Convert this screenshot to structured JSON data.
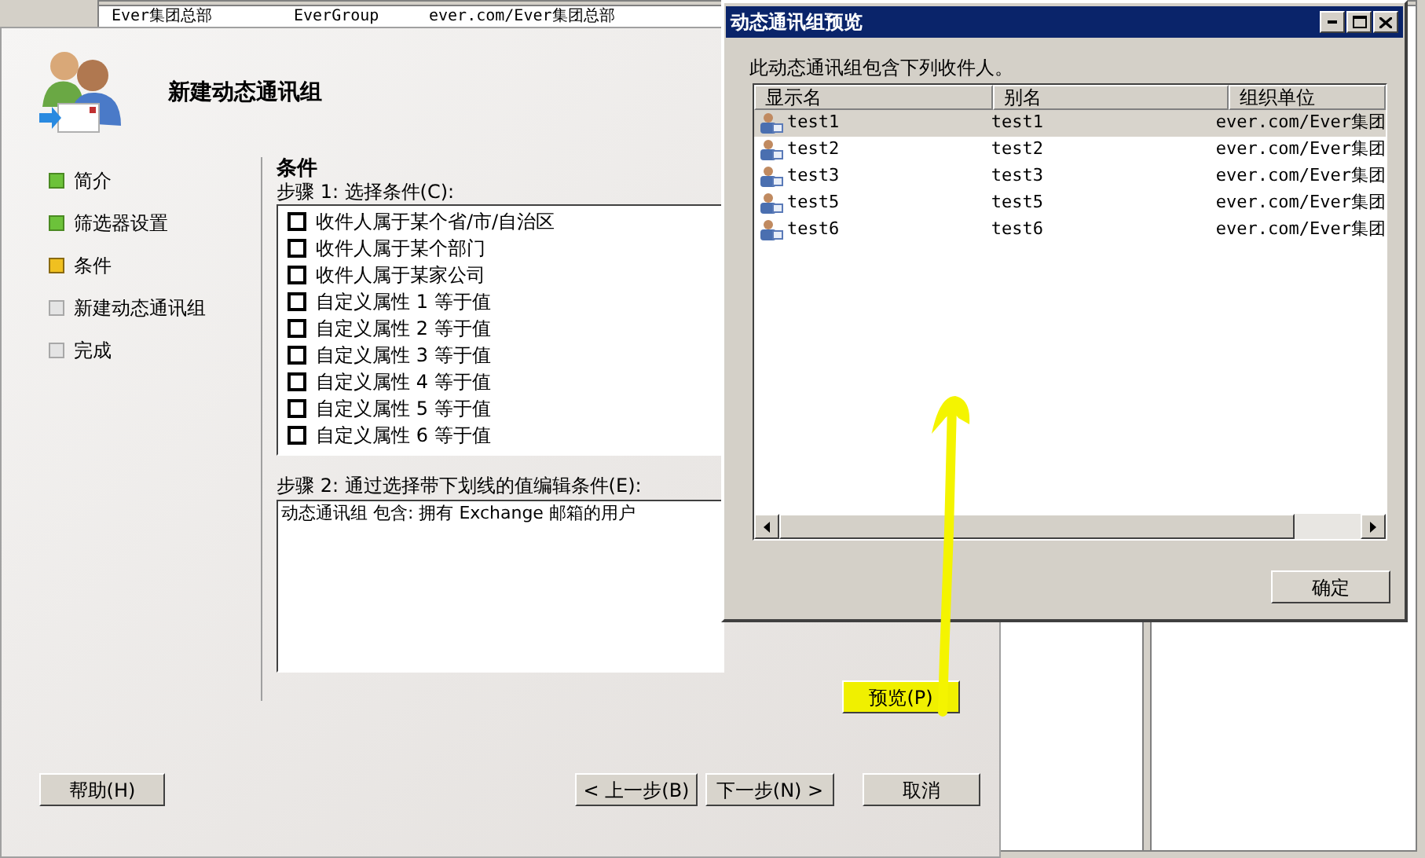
{
  "background_window": {
    "row": {
      "display_name": "Ever集团总部",
      "alias": "EverGroup",
      "org_unit": "ever.com/Ever集团总部"
    }
  },
  "wizard": {
    "title": "新建动态通讯组",
    "steps": [
      {
        "label": "简介",
        "kind": "done"
      },
      {
        "label": "筛选器设置",
        "kind": "done"
      },
      {
        "label": "条件",
        "kind": "current"
      },
      {
        "label": "新建动态通讯组",
        "kind": "pending"
      },
      {
        "label": "完成",
        "kind": "pending"
      }
    ],
    "section_title": "条件",
    "step1_label": "步骤 1: 选择条件(C):",
    "conditions": [
      {
        "label": "收件人属于某个省/市/自治区",
        "checked": false
      },
      {
        "label": "收件人属于某个部门",
        "checked": false
      },
      {
        "label": "收件人属于某家公司",
        "checked": false
      },
      {
        "label": "自定义属性 1 等于值",
        "checked": false
      },
      {
        "label": "自定义属性 2 等于值",
        "checked": false
      },
      {
        "label": "自定义属性 3 等于值",
        "checked": false
      },
      {
        "label": "自定义属性 4 等于值",
        "checked": false
      },
      {
        "label": "自定义属性 5 等于值",
        "checked": false
      },
      {
        "label": "自定义属性 6 等于值",
        "checked": false
      }
    ],
    "step2_label": "步骤 2: 通过选择带下划线的值编辑条件(E):",
    "condition_text": "动态通讯组 包含: 拥有 Exchange 邮箱的用户",
    "preview_button": "预览(P)",
    "help_button": "帮助(H)",
    "back_button": "< 上一步(B)",
    "next_button": "下一步(N) >",
    "cancel_button": "取消"
  },
  "preview_dialog": {
    "title": "动态通讯组预览",
    "intro": "此动态通讯组包含下列收件人。",
    "columns": [
      "显示名",
      "别名",
      "组织单位"
    ],
    "rows": [
      {
        "display_name": "test1",
        "alias": "test1",
        "org_unit": "ever.com/Ever集团",
        "selected": true
      },
      {
        "display_name": "test2",
        "alias": "test2",
        "org_unit": "ever.com/Ever集团",
        "selected": false
      },
      {
        "display_name": "test3",
        "alias": "test3",
        "org_unit": "ever.com/Ever集团",
        "selected": false
      },
      {
        "display_name": "test5",
        "alias": "test5",
        "org_unit": "ever.com/Ever集团",
        "selected": false
      },
      {
        "display_name": "test6",
        "alias": "test6",
        "org_unit": "ever.com/Ever集团",
        "selected": false
      }
    ],
    "ok_button": "确定"
  }
}
